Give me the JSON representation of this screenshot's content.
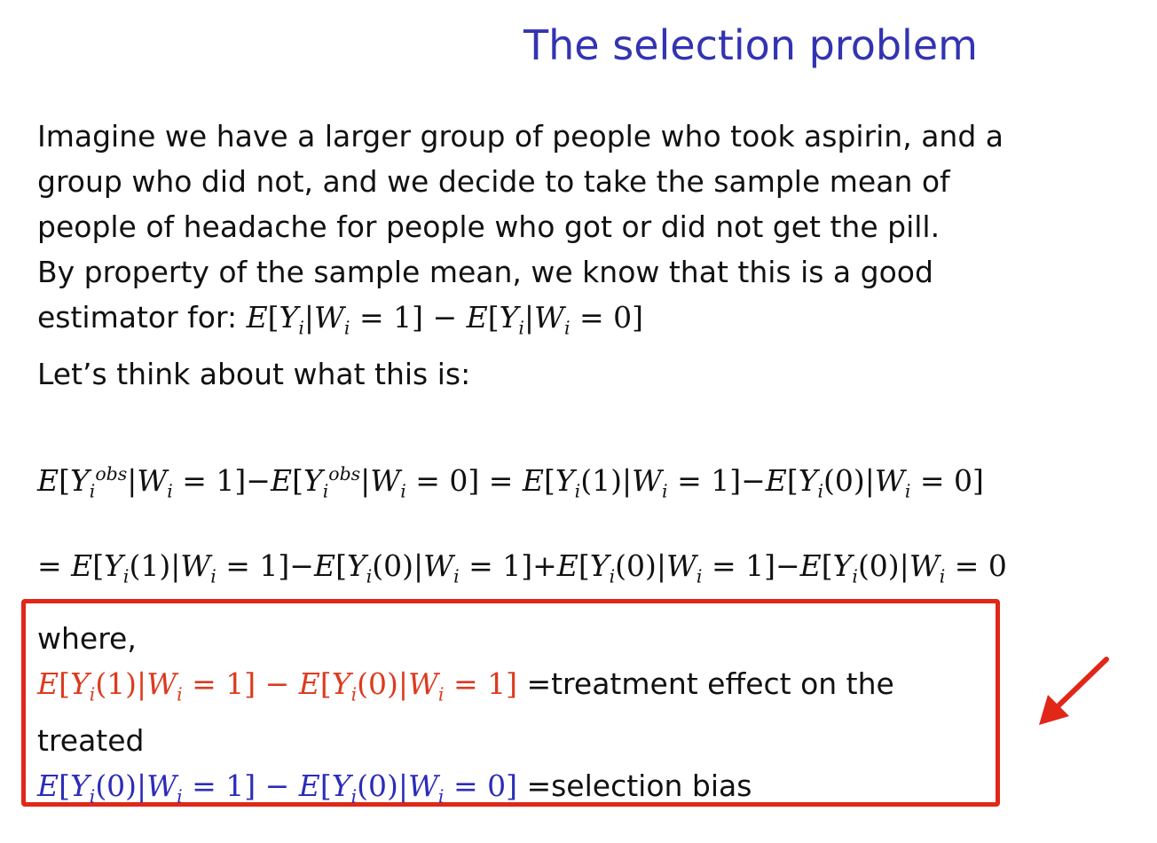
{
  "title": "The selection problem",
  "paragraph": {
    "line1": "Imagine we have a larger group of people who took aspirin, and a",
    "line2": "group who did not, and we decide to take the sample mean of",
    "line3": "people of headache for people who got or did not get the pill.",
    "line4": "By property of the sample mean, we know that this is a good",
    "line5_prefix": "estimator for: ",
    "line5_formula": "E[Y_i|W_i = 1] − E[Y_i|W_i = 0]",
    "line6": "Let’s think about what this is:"
  },
  "equations": {
    "eq1": "E[Y_i^obs|W_i = 1]−E[Y_i^obs|W_i = 0] = E[Y_i(1)|W_i = 1]−E[Y_i(0)|W_i = 0]",
    "eq2": "= E[Y_i(1)|W_i = 1]−E[Y_i(0)|W_i = 1]+E[Y_i(0)|W_i = 1]−E[Y_i(0)|W_i = 0]"
  },
  "box": {
    "where": "where,",
    "att_formula": "E[Y_i(1)|W_i = 1] − E[Y_i(0)|W_i = 1]",
    "att_label": "=treatment effect on the",
    "att_label_cont": "treated",
    "bias_formula": "E[Y_i(0)|W_i = 1] − E[Y_i(0)|W_i = 0]",
    "bias_label": "=selection bias"
  },
  "colors": {
    "title": "#3333b2",
    "att": "#dd3a1f",
    "bias": "#2c2cb8",
    "box_border": "#e02718",
    "arrow": "#e02718"
  },
  "icons": {
    "arrow": "arrow-down-left-icon"
  }
}
